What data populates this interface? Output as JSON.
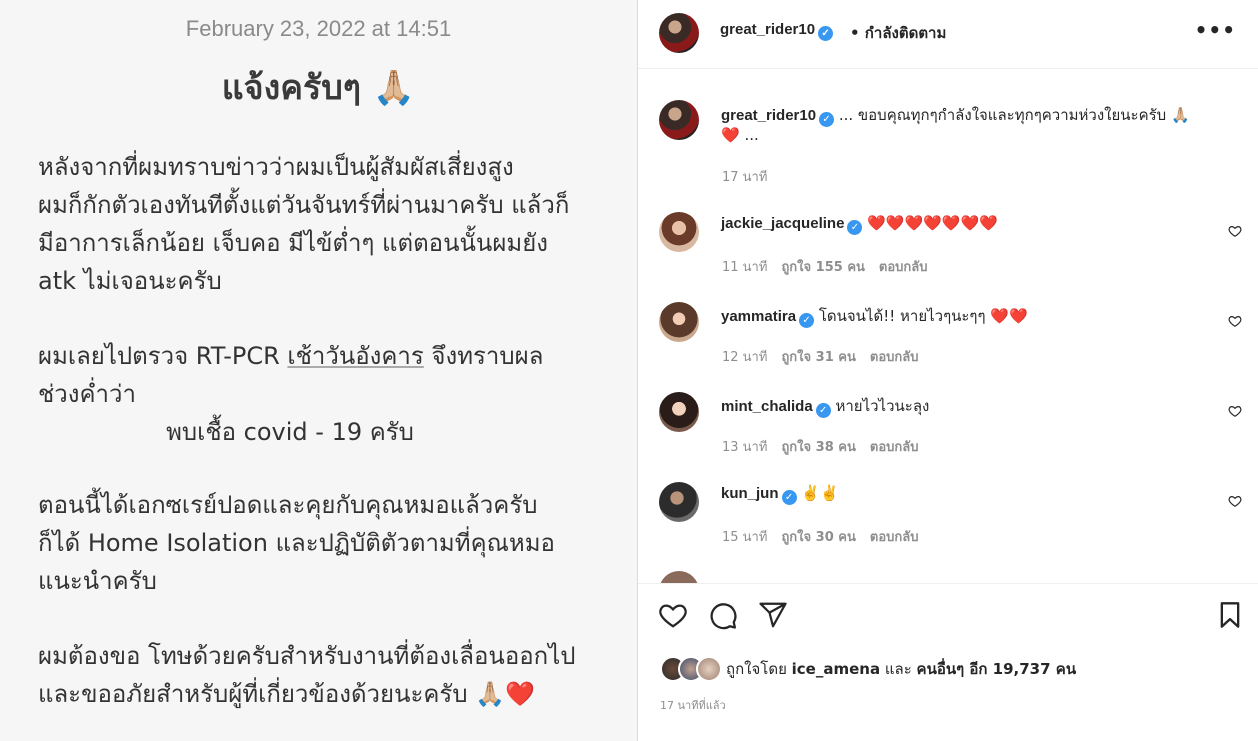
{
  "note": {
    "date": "February 23, 2022 at 14:51",
    "title": "แจ้งครับๆ 🙏🏼",
    "p1": [
      "หลังจากที่ผมทราบข่าวว่าผมเป็นผู้สัมผัสเสี่ยงสูง",
      "ผมก็กักตัวเองทันทีตั้งแต่วันจันทร์ที่ผ่านมาครับ แล้วก็",
      "มีอาการเล็กน้อย เจ็บคอ มีไข้ต่ำๆ แต่ตอนนั้นผมยัง",
      "atk ไม่เจอนะครับ"
    ],
    "p2_a": "ผมเลยไปตรวจ RT-PCR ",
    "p2_u": "เช้าวันอังคาร",
    "p2_b": " จึงทราบผล",
    "p2_line2": "ช่วงค่ำว่า",
    "p2_center": "พบเชื้อ covid - 19 ครับ",
    "p3": [
      "ตอนนี้ได้เอกซเรย์ปอดและคุยกับคุณหมอแล้วครับ",
      "ก็ได้ Home Isolation และปฏิบัติตัวตามที่คุณหมอ",
      "แนะนำครับ"
    ],
    "p4": [
      "ผมต้องขอ โทษด้วยครับสำหรับงานที่ต้องเลื่อนออกไป",
      "และขออภัยสำหรับผู้ที่เกี่ยวข้องด้วยนะครับ 🙏🏼❤️"
    ]
  },
  "header": {
    "username": "great_rider10",
    "follow": "• กำลังติดตาม",
    "more": "•••"
  },
  "caption": {
    "username": "great_rider10",
    "text": "... ขอบคุณทุกๆกำลังใจและทุกๆความห่วงใยนะครับ 🙏🏼",
    "text2": "❤️ ...",
    "time": "17 นาที"
  },
  "comments": [
    {
      "username": "jackie_jacqueline",
      "text": "❤️❤️❤️❤️❤️❤️❤️",
      "time": "11 นาที",
      "likes": "ถูกใจ 155 คน",
      "reply": "ตอบกลับ"
    },
    {
      "username": "yammatira",
      "text": "โดนจนได้!! หายไวๆนะๆๆ ❤️❤️",
      "time": "12 นาที",
      "likes": "ถูกใจ 31 คน",
      "reply": "ตอบกลับ"
    },
    {
      "username": "mint_chalida",
      "text": "หายไวไวนะลุง",
      "time": "13 นาที",
      "likes": "ถูกใจ 38 คน",
      "reply": "ตอบกลับ"
    },
    {
      "username": "kun_jun",
      "text": "✌️✌️",
      "time": "15 นาที",
      "likes": "ถูกใจ 30 คน",
      "reply": "ตอบกลับ"
    }
  ],
  "likes": {
    "prefix": "ถูกใจโดย ",
    "user": "ice_amena",
    "mid": " และ ",
    "others": "คนอื่นๆ อีก 19,737 คน"
  },
  "posted_ago": "17 นาทีที่แล้ว",
  "colors": {
    "verified": "#3897f0",
    "muted": "#8e8e8e",
    "note_bg": "#f6f6f6"
  }
}
